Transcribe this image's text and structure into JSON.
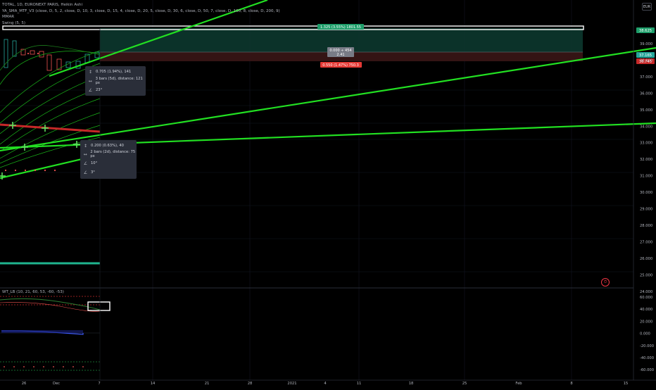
{
  "legend": {
    "symbol_line": "TOTAL, 1D, EURONEXT PARIS, Heikin Ashi",
    "indicator_1": "YA_SMA_MTF_V3 (close, D, 5, 2, close, D, 10, 3, close, D, 15, 4, close, D, 20, 5, close, D, 30, 6, close, D, 50, 7, close, D, 100, 8, close, D, 200, 9)",
    "indicator_2": "MMAR",
    "indicator_3": "Swing (5, 5)"
  },
  "oscillator": {
    "label": "WT_LB (10, 21, 60, 53, -60, -53)"
  },
  "price_axis": {
    "currency": "EUR",
    "ticks": [
      "39.000",
      "38.000",
      "37.000",
      "36.000",
      "35.000",
      "34.000",
      "33.000",
      "32.000",
      "31.000",
      "30.000",
      "29.000",
      "28.000",
      "27.000",
      "26.000",
      "25.000",
      "24.000"
    ],
    "labels": [
      {
        "text": "38.625",
        "bg": "#1e9e6a"
      },
      {
        "text": "37.165",
        "bg": "#26a69a"
      },
      {
        "text": "36.745",
        "bg": "#c62828"
      }
    ]
  },
  "osc_axis": {
    "ticks": [
      "60.000",
      "40.000",
      "20.000",
      "0.000",
      "-20.000",
      "-40.000",
      "-60.000"
    ]
  },
  "time_axis": {
    "ticks": [
      "26",
      "Dec",
      "7",
      "14",
      "21",
      "28",
      "2021",
      "4",
      "11",
      "18",
      "25",
      "Feb",
      "8",
      "15"
    ]
  },
  "measure": {
    "target_label": "1.325 (3.55%) 1801.55",
    "entry_label_1": "0.000 ÷ 454",
    "entry_label_2": "2.41",
    "stop_label": "0.550 (1.47%) 750.3"
  },
  "tooltip_1": {
    "row1": "0.705 (1.94%), 141",
    "row2": "3 bars (5d), distance: 121 px",
    "row3": "23°"
  },
  "tooltip_2": {
    "row1": "0.200 (0.63%), 40",
    "row2": "2 bars (2d), distance: 75 px",
    "row3": "10°",
    "row4": "3°"
  },
  "icons": {
    "price_row": "arrows-vertical-icon",
    "bars_row": "arrows-horizontal-icon",
    "angle_row": "angle-icon",
    "alert": "alert-clock-icon"
  },
  "colors": {
    "background": "#000000",
    "line_green": "#22e022",
    "target_zone": "#0d3b30",
    "stop_zone": "#3a1616",
    "bull": "#26a69a",
    "bear": "#ef5350"
  }
}
